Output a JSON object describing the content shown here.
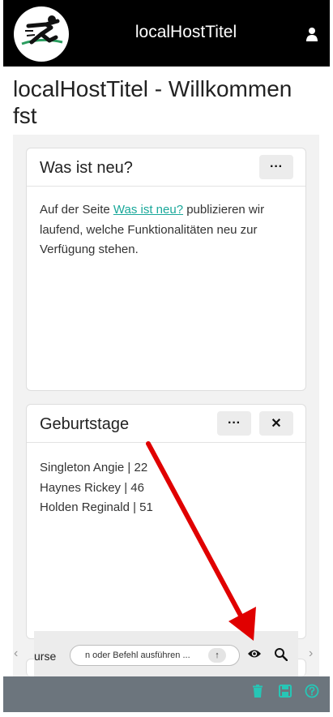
{
  "header": {
    "app_title": "localHostTitel",
    "logo_icon": "runner-logo-icon",
    "user_icon": "user-icon"
  },
  "page": {
    "title": "localHostTitel - Willkommen fst"
  },
  "cards": {
    "news": {
      "title": "Was ist neu?",
      "menu_label": "···",
      "text_1": "Auf der Seite ",
      "link": "Was ist neu?",
      "text_2": " publizieren wir",
      "text_3": "laufend, welche Funktionalitäten neu zur",
      "text_4": "Verfügung stehen."
    },
    "birthdays": {
      "title": "Geburtstage",
      "menu_label": "···",
      "close_label": "✕",
      "items": [
        "Singleton Angie | 22",
        "Haynes Rickey | 46",
        "Holden Reginald | 51"
      ]
    }
  },
  "command_bar": {
    "label": "urse",
    "placeholder": "n oder Befehl ausführen ...",
    "submit_label": "↑",
    "nav_prev": "‹",
    "nav_next": "›"
  },
  "colors": {
    "accent": "#1aa89a",
    "annotation_arrow": "#e00000",
    "bottom_bar": "#6c757d",
    "top_bar": "#000000"
  }
}
